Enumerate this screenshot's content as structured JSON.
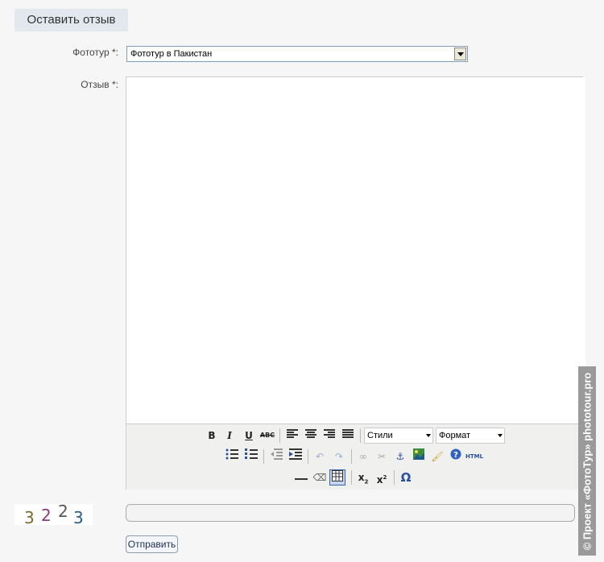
{
  "tab": {
    "label": "Оставить отзыв"
  },
  "form": {
    "tour_label": "Фототур",
    "review_label": "Отзыв",
    "required_mark": "*:",
    "tour_selected": "Фототур в Пакистан",
    "submit_label": "Отправить"
  },
  "toolbar": {
    "bold": "B",
    "italic": "I",
    "underline": "U",
    "strike": "ABC",
    "styles_label": "Стили",
    "format_label": "Формат",
    "html_label": "HTML",
    "omega": "Ω"
  },
  "captcha": {
    "digits": [
      "3",
      "2",
      "2",
      "3"
    ]
  },
  "watermark": {
    "text": "© Проект «ФотоТур» phototour.pro"
  }
}
